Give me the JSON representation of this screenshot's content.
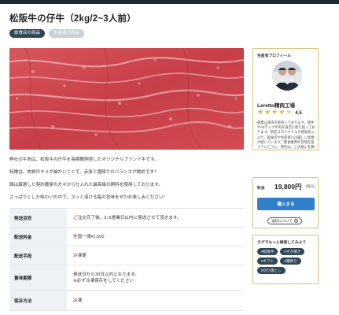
{
  "product": {
    "title": "松阪牛の仔牛（2kg/2~3人前）",
    "tags": [
      "飲食店の商品",
      "生産者の商品"
    ]
  },
  "hero": {
    "prev_icon": "chevron-left-icon",
    "next_icon": "chevron-right-icon"
  },
  "description": [
    "弊社の牛肉は、松阪牛の仔牛を長期間飼育したオリジナルブランド牛です。",
    "特徴は、肉質のキメが細かいことで、赤身と霜降りのバランスが絶妙です！",
    "餌は厳選した契約農家の方々から仕入れた最高級の飼料を使用しております。",
    "さっぱりとした味わいの中で、スッと溶ける脂の旨味をぜひお楽しみください！"
  ],
  "specs": [
    {
      "key": "発送目安",
      "value": "ご注文完了後、3~5営業日以内に発送させて頂きます。",
      "note": ""
    },
    {
      "key": "配送料金",
      "value": "全国一律¥1,500",
      "note": ""
    },
    {
      "key": "配送手段",
      "value": "冷凍便",
      "note": ""
    },
    {
      "key": "賞味期限",
      "value": "発送日から30日以内となります。",
      "note": "※必ず冷凍保存をしてください"
    },
    {
      "key": "保存方法",
      "value": "冷凍",
      "note": ""
    }
  ],
  "profile": {
    "label": "生産者プロフィール",
    "shop_name": "Leretto精肉工場",
    "rating": "4.5",
    "rating_value": 4.5,
    "rating_max": 5,
    "text": "創業以来肉を販売しております。和牛やA5ランクの肉を直営に取り扱っております。新型コロナウイルス感染症により、飲食店や生産者には厳しい状態が続いています。飲食業界の苦境を変えていこうと、弊社は、この想いを胸に取り組む為に肉通販マニアを立ち上げました"
  },
  "purchase": {
    "price_label": "料金",
    "price": "19,800円",
    "tax": "(税込)",
    "buy_label": "購入する",
    "about_label": "送料について"
  },
  "tag_search": {
    "label": "タグでもっと検索してみよう",
    "tags": [
      "#松阪牛",
      "#すき焼き",
      "#ギフト",
      "#霜降り",
      "#切り落とし"
    ]
  },
  "colors": {
    "accent": "#2f80c9",
    "tag_dark": "#2f4656",
    "border_gold": "#d9c27a",
    "star": "#e7b23a",
    "topbar": "#1f2a37"
  }
}
